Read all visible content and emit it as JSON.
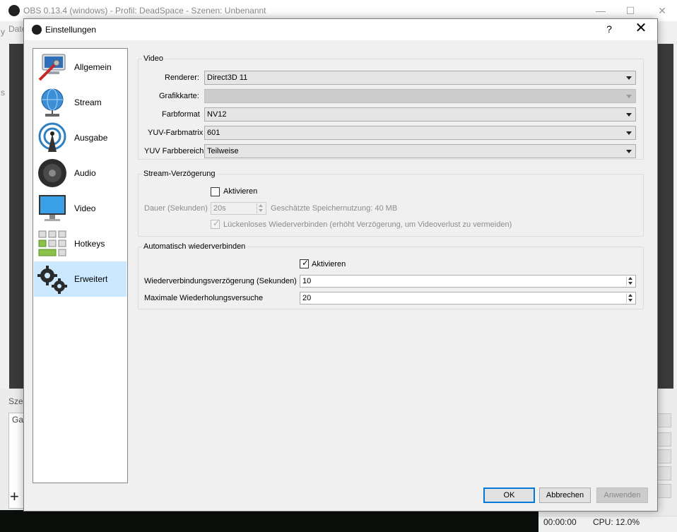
{
  "main_window": {
    "title": "OBS 0.13.4 (windows) - Profil: DeadSpace - Szenen: Unbenannt",
    "menu_fragment": "Date",
    "left_edge_fragment_1": "y",
    "left_edge_fragment_2": "s",
    "scenes_label": "Szen",
    "scene_item": "Gar",
    "add_symbol": "+",
    "minimize_glyph": "—",
    "maximize_glyph": "☐",
    "close_glyph": "✕",
    "status_time": "00:00:00",
    "status_cpu": "CPU: 12.0%"
  },
  "dialog": {
    "title": "Einstellungen",
    "help_glyph": "?",
    "close_glyph": "✕"
  },
  "sidebar": {
    "items": [
      {
        "label": "Allgemein",
        "icon": "general-settings-icon"
      },
      {
        "label": "Stream",
        "icon": "globe-network-icon"
      },
      {
        "label": "Ausgabe",
        "icon": "broadcast-antenna-icon"
      },
      {
        "label": "Audio",
        "icon": "speaker-icon"
      },
      {
        "label": "Video",
        "icon": "monitor-icon"
      },
      {
        "label": "Hotkeys",
        "icon": "keyboard-keys-icon"
      },
      {
        "label": "Erweitert",
        "icon": "gears-icon"
      }
    ],
    "active": "Erweitert"
  },
  "video_group": {
    "title": "Video",
    "renderer_label": "Renderer:",
    "renderer_value": "Direct3D 11",
    "gpu_label": "Grafikkarte:",
    "gpu_value": "",
    "color_format_label": "Farbformat",
    "color_format_value": "NV12",
    "yuv_matrix_label": "YUV-Farbmatrix",
    "yuv_matrix_value": "601",
    "yuv_range_label": "YUV Farbbereich",
    "yuv_range_value": "Teilweise"
  },
  "delay_group": {
    "title": "Stream-Verzögerung",
    "enable_label": "Aktivieren",
    "enable_checked": false,
    "duration_label": "Dauer (Sekunden)",
    "duration_value": "20s",
    "memory_label": "Geschätzte Speichernutzung: 40 MB",
    "preserve_label": "Lückenloses Wiederverbinden (erhöht Verzögerung, um Videoverlust zu vermeiden)",
    "preserve_checked": true,
    "checkmark": "✓"
  },
  "reconnect_group": {
    "title": "Automatisch wiederverbinden",
    "enable_label": "Aktivieren",
    "enable_checked": true,
    "delay_label": "Wiederverbindungsverzögerung (Sekunden)",
    "delay_value": "10",
    "retries_label": "Maximale Wiederholungsversuche",
    "retries_value": "20",
    "checkmark": "✓"
  },
  "buttons": {
    "ok": "OK",
    "cancel": "Abbrechen",
    "apply": "Anwenden"
  }
}
